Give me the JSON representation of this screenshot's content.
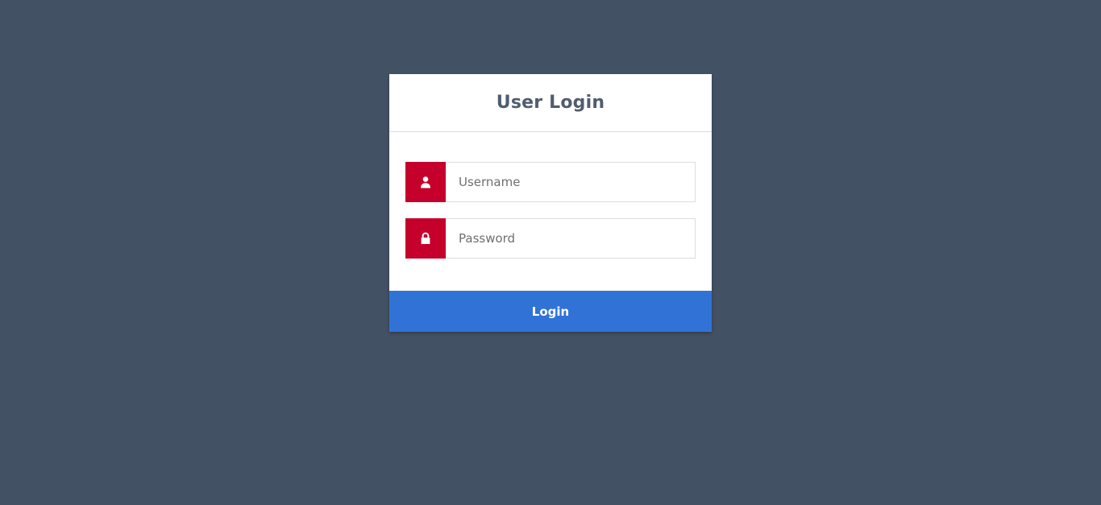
{
  "login": {
    "title": "User Login",
    "username": {
      "icon": "user-icon",
      "placeholder": "Username",
      "value": ""
    },
    "password": {
      "icon": "lock-icon",
      "placeholder": "Password",
      "value": ""
    },
    "submit_label": "Login"
  },
  "colors": {
    "page_background": "#435164",
    "card_background": "#ffffff",
    "title_text": "#515d6e",
    "icon_addon": "#c4002b",
    "button": "#3172d6",
    "button_text": "#ffffff"
  }
}
